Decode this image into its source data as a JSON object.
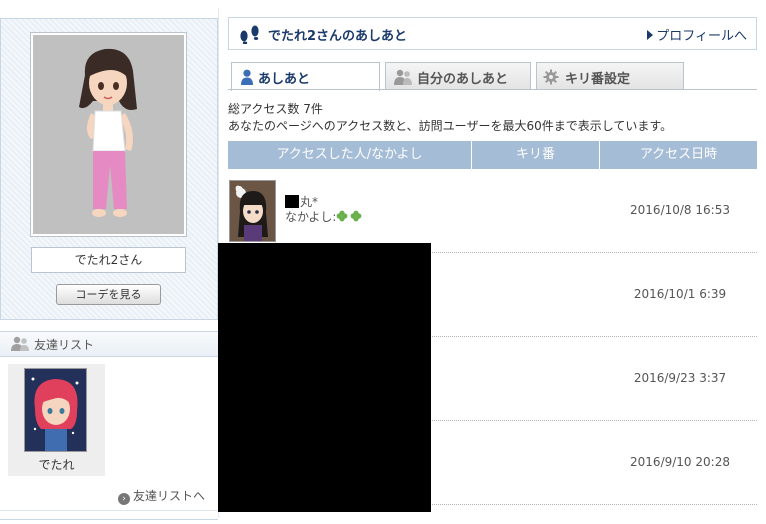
{
  "profile": {
    "name": "でたれ2さん",
    "coord_button": "コーデを見る"
  },
  "friends": {
    "header": "友達リスト",
    "items": [
      {
        "name": "でたれ"
      }
    ],
    "more_link": "友達リストへ"
  },
  "page": {
    "title": "でたれ2さんのあしあと",
    "profile_link": "プロフィールへ"
  },
  "tabs": [
    {
      "label": "あしあと",
      "active": true,
      "icon": "person-icon"
    },
    {
      "label": "自分のあしあと",
      "active": false,
      "icon": "people-icon"
    },
    {
      "label": "キリ番設定",
      "active": false,
      "icon": "gear-icon"
    }
  ],
  "summary": {
    "total": "総アクセス数 7件",
    "description": "あなたのページへのアクセス数と、訪問ユーザーを最大60件まで表示しています。"
  },
  "table": {
    "headers": [
      "アクセスした人/なかよし",
      "キリ番",
      "アクセス日時"
    ],
    "rows": [
      {
        "name_suffix": "丸*",
        "friend_label": "なかよし:",
        "datetime": "2016/10/8 16:53"
      },
      {
        "datetime": "2016/10/1 6:39"
      },
      {
        "datetime": "2016/9/23 3:37"
      },
      {
        "datetime": "2016/9/10 20:28"
      }
    ]
  },
  "colors": {
    "header_bg": "#a4bcd6",
    "title_text": "#1a3a6b",
    "clover": "#6ab04c"
  }
}
